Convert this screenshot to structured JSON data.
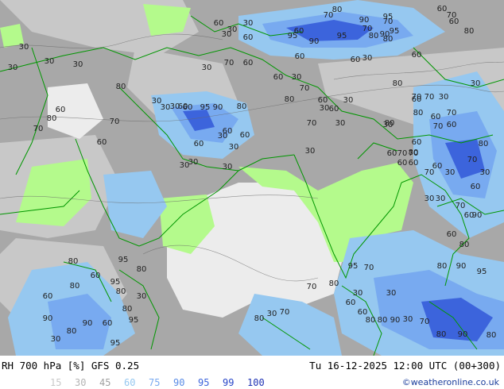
{
  "title": "RH 700 hPa [%] GFS 0.25",
  "valid_time": "Tu 16-12-2025 12:00 UTC (00+300)",
  "credit": "©weatheronline.co.uk",
  "legend": [
    {
      "value": "15",
      "color": "#c8c8c8"
    },
    {
      "value": "30",
      "color": "#b4b4b4"
    },
    {
      "value": "45",
      "color": "#a0a0a0"
    },
    {
      "value": "60",
      "color": "#96c8f0"
    },
    {
      "value": "75",
      "color": "#78aaf0"
    },
    {
      "value": "90",
      "color": "#5a8ce6"
    },
    {
      "value": "95",
      "color": "#3c64dc"
    },
    {
      "value": "99",
      "color": "#2846c8"
    },
    {
      "value": "100",
      "color": "#1e32b4"
    }
  ],
  "colors": {
    "map_background": "#a8a8a8",
    "light_dry": "#ececec",
    "medium_dry": "#c8c8c8",
    "green_band": "#b4fa8c",
    "moist_light": "#96c8f0",
    "moist": "#78aaf0",
    "very_moist": "#3c64dc",
    "border_lines": "#009600"
  },
  "contour_labels": [
    {
      "text": "60"
    },
    {
      "text": "30"
    },
    {
      "text": "30"
    },
    {
      "text": "30"
    },
    {
      "text": "60"
    },
    {
      "text": "70"
    },
    {
      "text": "80"
    },
    {
      "text": "90"
    },
    {
      "text": "95"
    },
    {
      "text": "60"
    },
    {
      "text": "70"
    },
    {
      "text": "30"
    },
    {
      "text": "30"
    },
    {
      "text": "30"
    },
    {
      "text": "70"
    },
    {
      "text": "60"
    },
    {
      "text": "30"
    },
    {
      "text": "60"
    },
    {
      "text": "95"
    },
    {
      "text": "95"
    },
    {
      "text": "90"
    },
    {
      "text": "60"
    },
    {
      "text": "60"
    },
    {
      "text": "30"
    },
    {
      "text": "80"
    },
    {
      "text": "90"
    },
    {
      "text": "95"
    },
    {
      "text": "80"
    },
    {
      "text": "70"
    },
    {
      "text": "60"
    },
    {
      "text": "70"
    },
    {
      "text": "60"
    },
    {
      "text": "80"
    },
    {
      "text": "70"
    },
    {
      "text": "30"
    },
    {
      "text": "30"
    },
    {
      "text": "80"
    },
    {
      "text": "60"
    },
    {
      "text": "30"
    },
    {
      "text": "80"
    },
    {
      "text": "70"
    },
    {
      "text": "80"
    },
    {
      "text": "90"
    },
    {
      "text": "95"
    },
    {
      "text": "30"
    },
    {
      "text": "60"
    },
    {
      "text": "30"
    },
    {
      "text": "30"
    },
    {
      "text": "60"
    },
    {
      "text": "30"
    },
    {
      "text": "80"
    },
    {
      "text": "70"
    },
    {
      "text": "60"
    },
    {
      "text": "80"
    },
    {
      "text": "70"
    },
    {
      "text": "60"
    },
    {
      "text": "60"
    },
    {
      "text": "30"
    },
    {
      "text": "60"
    },
    {
      "text": "60"
    },
    {
      "text": "30"
    },
    {
      "text": "30"
    },
    {
      "text": "30"
    },
    {
      "text": "30"
    },
    {
      "text": "30"
    },
    {
      "text": "30"
    },
    {
      "text": "60"
    },
    {
      "text": "30"
    },
    {
      "text": "30"
    },
    {
      "text": "70"
    },
    {
      "text": "60"
    },
    {
      "text": "80"
    },
    {
      "text": "80"
    },
    {
      "text": "60"
    },
    {
      "text": "70"
    },
    {
      "text": "70"
    },
    {
      "text": "60"
    },
    {
      "text": "60"
    },
    {
      "text": "80"
    },
    {
      "text": "70"
    },
    {
      "text": "30"
    },
    {
      "text": "60"
    },
    {
      "text": "60"
    },
    {
      "text": "70"
    },
    {
      "text": "30"
    },
    {
      "text": "60"
    },
    {
      "text": "70"
    },
    {
      "text": "80"
    },
    {
      "text": "60"
    },
    {
      "text": "30"
    },
    {
      "text": "70"
    },
    {
      "text": "60"
    },
    {
      "text": "60"
    },
    {
      "text": "80"
    },
    {
      "text": "90"
    },
    {
      "text": "30"
    },
    {
      "text": "60"
    },
    {
      "text": "70"
    },
    {
      "text": "30"
    },
    {
      "text": "60"
    },
    {
      "text": "70"
    },
    {
      "text": "80"
    },
    {
      "text": "90"
    },
    {
      "text": "95"
    },
    {
      "text": "80"
    },
    {
      "text": "90"
    },
    {
      "text": "80"
    },
    {
      "text": "70"
    },
    {
      "text": "30"
    },
    {
      "text": "90"
    },
    {
      "text": "80"
    },
    {
      "text": "80"
    },
    {
      "text": "30"
    },
    {
      "text": "60"
    },
    {
      "text": "80"
    },
    {
      "text": "70"
    },
    {
      "text": "95"
    },
    {
      "text": "30"
    },
    {
      "text": "60"
    },
    {
      "text": "70"
    },
    {
      "text": "70"
    },
    {
      "text": "30"
    },
    {
      "text": "80"
    },
    {
      "text": "90"
    },
    {
      "text": "30"
    },
    {
      "text": "80"
    },
    {
      "text": "90"
    },
    {
      "text": "95"
    },
    {
      "text": "60"
    },
    {
      "text": "80"
    },
    {
      "text": "60"
    },
    {
      "text": "80"
    },
    {
      "text": "95"
    },
    {
      "text": "60"
    },
    {
      "text": "80"
    },
    {
      "text": "80"
    },
    {
      "text": "95"
    },
    {
      "text": "95"
    },
    {
      "text": "80"
    },
    {
      "text": "30"
    }
  ]
}
